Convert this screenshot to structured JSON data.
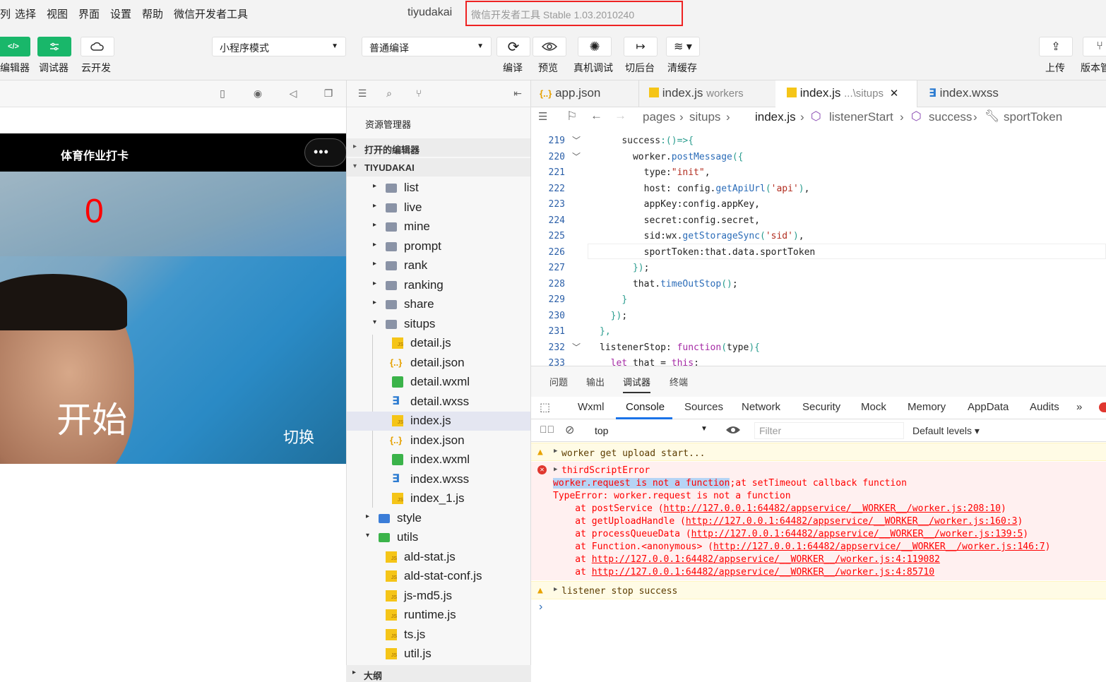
{
  "menubar": {
    "items": [
      "列",
      "选择",
      "视图",
      "界面",
      "设置",
      "帮助",
      "微信开发者工具"
    ],
    "window_title": "tiyudakai",
    "version": "微信开发者工具 Stable 1.03.2010240"
  },
  "toolbar": {
    "editor": "编辑器",
    "debugger": "调试器",
    "cloud": "云开发",
    "mode_select": "小程序模式",
    "compile_select": "普通编译",
    "compile": "编译",
    "preview": "预览",
    "real_debug": "真机调试",
    "background": "切后台",
    "clear_cache": "清缓存",
    "upload": "上传",
    "version_mgmt": "版本管"
  },
  "simulator": {
    "title": "体育作业打卡",
    "capsule": "•••",
    "counter": "0",
    "start": "开始",
    "switch": "切换"
  },
  "explorer": {
    "title": "资源管理器",
    "open_editors": "打开的编辑器",
    "project": "TIYUDAKAI",
    "outline": "大纲",
    "tree": [
      {
        "label": "list",
        "type": "folder",
        "depth": 1
      },
      {
        "label": "live",
        "type": "folder",
        "depth": 1
      },
      {
        "label": "mine",
        "type": "folder",
        "depth": 1
      },
      {
        "label": "prompt",
        "type": "folder",
        "depth": 1
      },
      {
        "label": "rank",
        "type": "folder",
        "depth": 1
      },
      {
        "label": "ranking",
        "type": "folder",
        "depth": 1
      },
      {
        "label": "share",
        "type": "folder",
        "depth": 1
      },
      {
        "label": "situps",
        "type": "folder-open",
        "depth": 1
      },
      {
        "label": "detail.js",
        "type": "js",
        "depth": 2
      },
      {
        "label": "detail.json",
        "type": "json",
        "depth": 2
      },
      {
        "label": "detail.wxml",
        "type": "wxml",
        "depth": 2
      },
      {
        "label": "detail.wxss",
        "type": "wxss",
        "depth": 2
      },
      {
        "label": "index.js",
        "type": "js",
        "depth": 2,
        "selected": true
      },
      {
        "label": "index.json",
        "type": "json",
        "depth": 2
      },
      {
        "label": "index.wxml",
        "type": "wxml",
        "depth": 2
      },
      {
        "label": "index.wxss",
        "type": "wxss",
        "depth": 2
      },
      {
        "label": "index_1.js",
        "type": "js",
        "depth": 2
      },
      {
        "label": "style",
        "type": "folder-blue",
        "depth": 0
      },
      {
        "label": "utils",
        "type": "folder-green",
        "depth": 0
      },
      {
        "label": "ald-stat.js",
        "type": "js",
        "depth": 1
      },
      {
        "label": "ald-stat-conf.js",
        "type": "js",
        "depth": 1
      },
      {
        "label": "js-md5.js",
        "type": "js",
        "depth": 1
      },
      {
        "label": "runtime.js",
        "type": "js",
        "depth": 1
      },
      {
        "label": "ts.js",
        "type": "js",
        "depth": 1
      },
      {
        "label": "util.js",
        "type": "js",
        "depth": 1
      }
    ]
  },
  "editor": {
    "tabs": [
      {
        "name": "app.json",
        "sub": ""
      },
      {
        "name": "index.js",
        "sub": "workers"
      },
      {
        "name": "index.js",
        "sub": "...\\situps"
      },
      {
        "name": "index.wxss",
        "sub": ""
      }
    ],
    "breadcrumb": [
      "pages",
      "situps",
      "index.js",
      "listenerStart",
      "success",
      "sportToken"
    ],
    "lines": [
      {
        "n": "219",
        "html": "    <span class='prop'>success</span><span class='pun'>:()=>{</span>"
      },
      {
        "n": "220",
        "html": "      worker.<span class='fn'>postMessage</span><span class='pun'>({</span>"
      },
      {
        "n": "221",
        "html": "        type:<span class='str'>\"init\"</span>,"
      },
      {
        "n": "222",
        "html": "        host: config.<span class='fn'>getApiUrl</span><span class='pun'>(</span><span class='str'>'api'</span><span class='pun'>)</span>,"
      },
      {
        "n": "223",
        "html": "        appKey:config.appKey,"
      },
      {
        "n": "224",
        "html": "        secret:config.secret,"
      },
      {
        "n": "225",
        "html": "        sid:wx.<span class='fn'>getStorageSync</span><span class='pun'>(</span><span class='str'>'sid'</span><span class='pun'>)</span>,"
      },
      {
        "n": "226",
        "html": "        sportToken:that.data.sportToken"
      },
      {
        "n": "227",
        "html": "      <span class='pun'>})</span>;"
      },
      {
        "n": "228",
        "html": "      that.<span class='fn'>timeOutStop</span><span class='pun'>()</span>;"
      },
      {
        "n": "229",
        "html": "    <span class='pun'>}</span>"
      },
      {
        "n": "230",
        "html": "  <span class='pun'>})</span>;"
      },
      {
        "n": "231",
        "html": "<span class='pun'>},</span>"
      },
      {
        "n": "232",
        "html": "listenerStop: <span class='kw'>function</span><span class='pun'>(</span>type<span class='pun'>){</span>"
      },
      {
        "n": "233",
        "html": "  <span class='kw'>let</span> that = <span class='kw'>this</span>;"
      }
    ]
  },
  "devtools": {
    "top_tabs": [
      "问题",
      "输出",
      "调试器",
      "终端"
    ],
    "tabs": [
      "Wxml",
      "Console",
      "Sources",
      "Network",
      "Security",
      "Mock",
      "Memory",
      "AppData",
      "Audits"
    ],
    "context": "top",
    "filter_placeholder": "Filter",
    "levels": "Default levels ▾",
    "msg_warn1": "worker get upload start...",
    "err_head": "thirdScriptError",
    "err_sel": "worker.request is not a function",
    "err_rest": ";at setTimeout callback function",
    "err_type": "TypeError: worker.request is not a function",
    "stack": [
      {
        "pre": "    at postService (",
        "url": "http://127.0.0.1:64482/appservice/__WORKER__/worker.js:208:10",
        "post": ")"
      },
      {
        "pre": "    at getUploadHandle (",
        "url": "http://127.0.0.1:64482/appservice/__WORKER__/worker.js:160:3",
        "post": ")"
      },
      {
        "pre": "    at processQueueData (",
        "url": "http://127.0.0.1:64482/appservice/__WORKER__/worker.js:139:5",
        "post": ")"
      },
      {
        "pre": "    at Function.<anonymous> (",
        "url": "http://127.0.0.1:64482/appservice/__WORKER__/worker.js:146:7",
        "post": ")"
      },
      {
        "pre": "    at ",
        "url": "http://127.0.0.1:64482/appservice/__WORKER__/worker.js:4:119082",
        "post": ""
      },
      {
        "pre": "    at ",
        "url": "http://127.0.0.1:64482/appservice/__WORKER__/worker.js:4:85710",
        "post": ""
      }
    ],
    "msg_warn2": "listener stop success",
    "prompt": "›"
  }
}
